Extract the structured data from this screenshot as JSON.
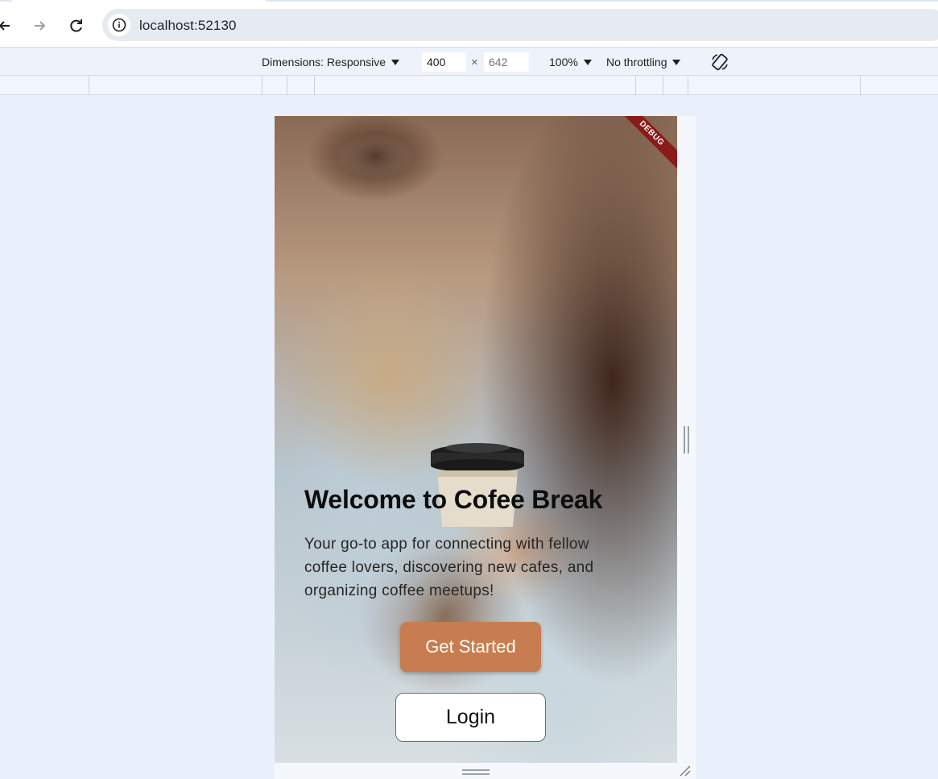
{
  "browser": {
    "url": "localhost:52130"
  },
  "device_toolbar": {
    "dimensions_label": "Dimensions: Responsive",
    "width_value": "400",
    "height_placeholder": "642",
    "times_symbol": "×",
    "zoom_label": "100%",
    "throttling_label": "No throttling"
  },
  "app": {
    "debug_label": "DEBUG",
    "title": "Welcome to Cofee Break",
    "subtitle": "Your go-to app for connecting with fellow coffee lovers, discovering new cafes, and organizing coffee meetups!",
    "primary_button": "Get Started",
    "secondary_button": "Login"
  },
  "colors": {
    "primary_button": "#c87d50",
    "debug_banner": "#8b1a1a",
    "page_background": "#eaf0fb"
  }
}
